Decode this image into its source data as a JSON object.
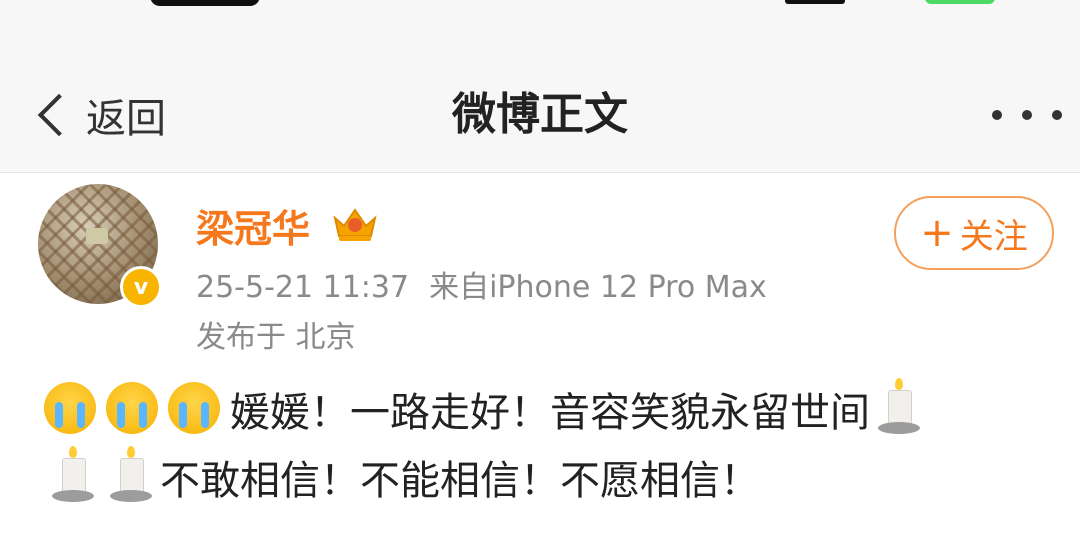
{
  "nav": {
    "back_label": "返回",
    "title": "微博正文",
    "more_icon": "more-dots-icon"
  },
  "post": {
    "author": "梁冠华",
    "verified_icon": "verified-badge-icon",
    "verified_glyph": "v",
    "crown_icon": "crown-badge-icon",
    "follow_label": "关注",
    "follow_plus": "+",
    "timestamp": "25-5-21 11:37",
    "source": "来自iPhone 12 Pro Max",
    "location": "发布于 北京",
    "text_line1": "媛媛！一路走好！音容笑貌永留世间",
    "text_line2": "不敢相信！不能相信！不愿相信！",
    "emoji_prefix": [
      "crying-emoji",
      "crying-emoji",
      "crying-emoji"
    ],
    "emoji_candles": [
      "candle-emoji",
      "candle-emoji",
      "candle-emoji"
    ]
  },
  "colors": {
    "accent": "#f5781c",
    "meta_gray": "#8a8a8a",
    "verified": "#f7b500"
  }
}
